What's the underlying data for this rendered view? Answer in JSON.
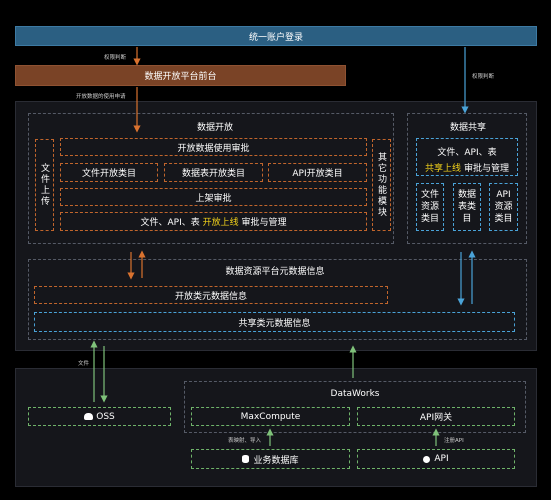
{
  "top": {
    "login": "统一账户登录",
    "perm_judge_left": "权限判断",
    "portal": "数据开放平台前台",
    "usage_request": "开放数据的使用申请",
    "perm_judge_right": "权限判断"
  },
  "open": {
    "title": "数据开放",
    "side_left": "文件上传",
    "approval": "开放数据使用审批",
    "cat_file": "文件开放类目",
    "cat_table": "数据表开放类目",
    "cat_api": "API开放类目",
    "shelf": "上架审批",
    "manage_prefix": "文件、API、表",
    "manage_highlight": "开放上线",
    "manage_suffix": "审批与管理",
    "side_right": "其它功能模块"
  },
  "share": {
    "title": "数据共享",
    "line1": "文件、API、表",
    "highlight": "共享上线",
    "suffix": "审批与管理",
    "cat_file": "文件资源类目",
    "cat_table": "数据表类目",
    "cat_api": "API资源类目"
  },
  "meta": {
    "title": "数据资源平台元数据信息",
    "open_meta": "开放类元数据信息",
    "share_meta": "共享类元数据信息"
  },
  "bottom": {
    "file_label": "文件",
    "oss": "OSS",
    "dataworks": "DataWorks",
    "maxcompute": "MaxCompute",
    "api_gateway": "API网关",
    "mapping_label": "表映射、导入",
    "register_api": "注册API",
    "biz_db": "业务数据库",
    "api": "API"
  },
  "colors": {
    "login_bg": "#2b5f82",
    "portal_bg": "#7a4326",
    "orange_arrow": "#d9722f",
    "blue_arrow": "#4aa3d8",
    "green_arrow": "#7fc27a",
    "highlight": "#f2d21b"
  },
  "icons": [
    "cloud-icon",
    "database-icon",
    "api-icon"
  ]
}
